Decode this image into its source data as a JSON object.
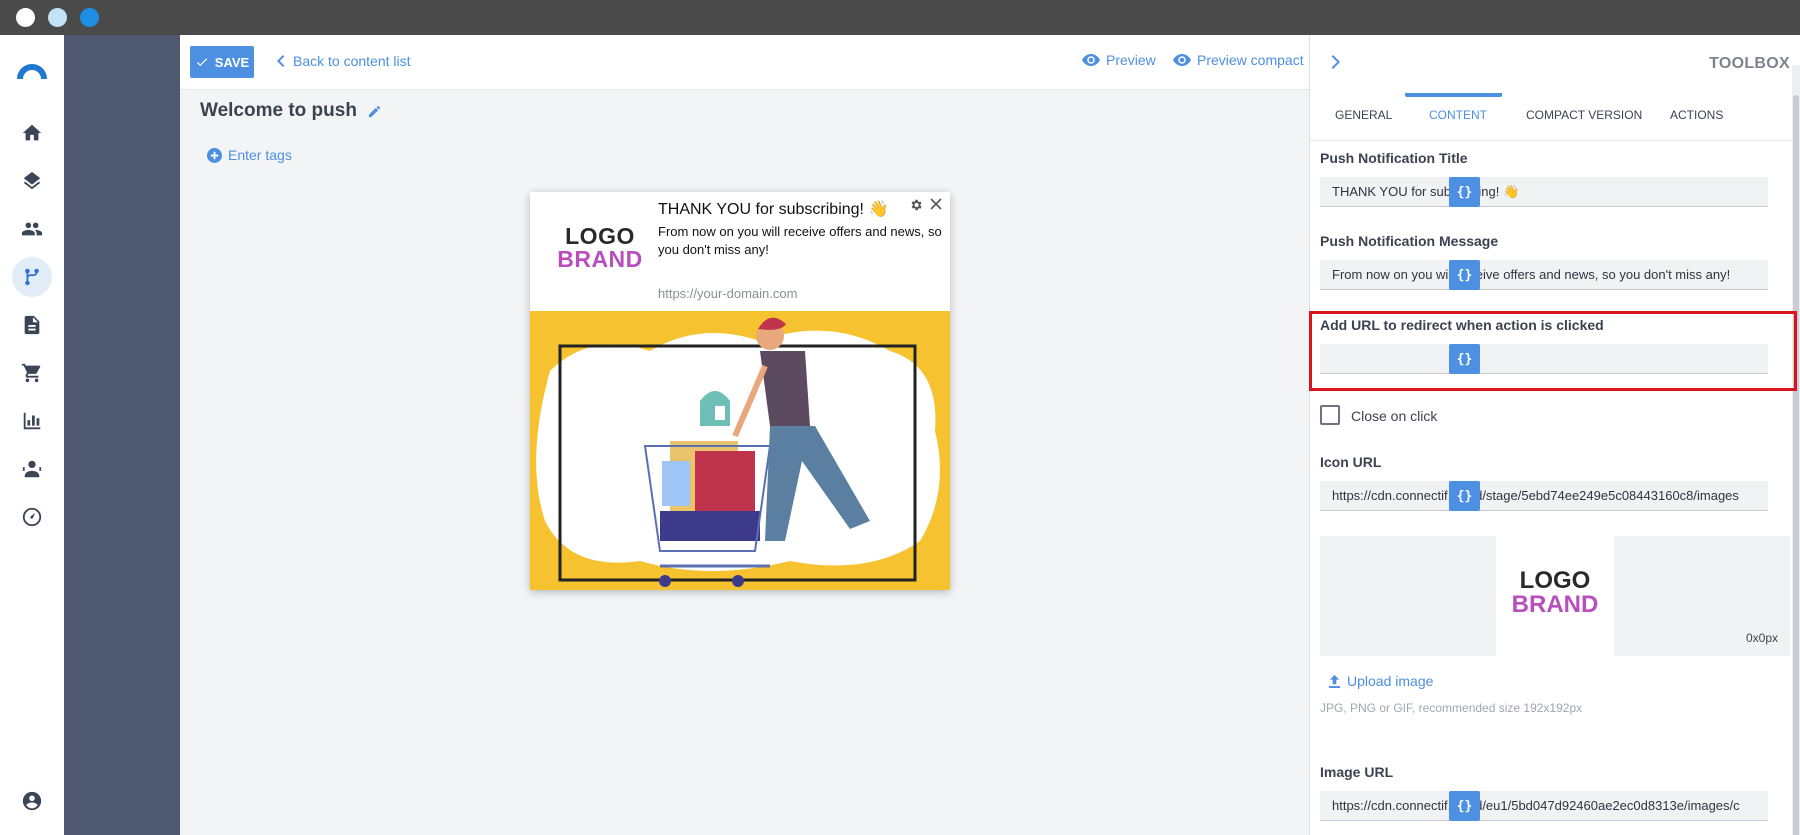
{
  "toolbar": {
    "save_label": "SAVE",
    "back_label": "Back to content list",
    "preview_label": "Preview",
    "preview_compact_label": "Preview compact"
  },
  "page": {
    "title": "Welcome to push",
    "tags_label": "Enter tags"
  },
  "preview_card": {
    "logo_line1": "LOGO",
    "logo_line2": "BRAND",
    "title": "THANK YOU for subscribing! 👋",
    "message": "From now on you will receive offers and news, so you don't miss any!",
    "domain": "https://your-domain.com"
  },
  "toolbox": {
    "title": "TOOLBOX",
    "tabs": [
      {
        "label": "GENERAL",
        "active": false
      },
      {
        "label": "CONTENT",
        "active": true
      },
      {
        "label": "COMPACT VERSION",
        "active": false
      },
      {
        "label": "ACTIONS",
        "active": false
      }
    ],
    "fields": {
      "title_label": "Push Notification Title",
      "title_value": "THANK YOU for subscribing! 👋",
      "message_label": "Push Notification Message",
      "message_value": "From now on you will receive offers and news, so you don't miss any!",
      "url_label": "Add URL to redirect when action is clicked",
      "url_value": "",
      "close_on_click_label": "Close on click",
      "close_on_click_checked": false,
      "icon_url_label": "Icon URL",
      "icon_url_value": "https://cdn.connectif.cloud/stage/5ebd74ee249e5c08443160c8/images",
      "icon_preview_size": "0x0px",
      "upload_label": "Upload image",
      "upload_hint": "JPG, PNG or GIF, recommended size 192x192px",
      "image_url_label": "Image URL",
      "image_url_value": "https://cdn.connectif.cloud/eu1/5bd047d92460ae2ec0d8313e/images/c"
    },
    "variable_button_label": "{}"
  },
  "colors": {
    "accent": "#4d8fe0",
    "sidebar_slate": "#4e5870",
    "highlight": "#d9141e",
    "logo_brand": "#b94fbd"
  }
}
